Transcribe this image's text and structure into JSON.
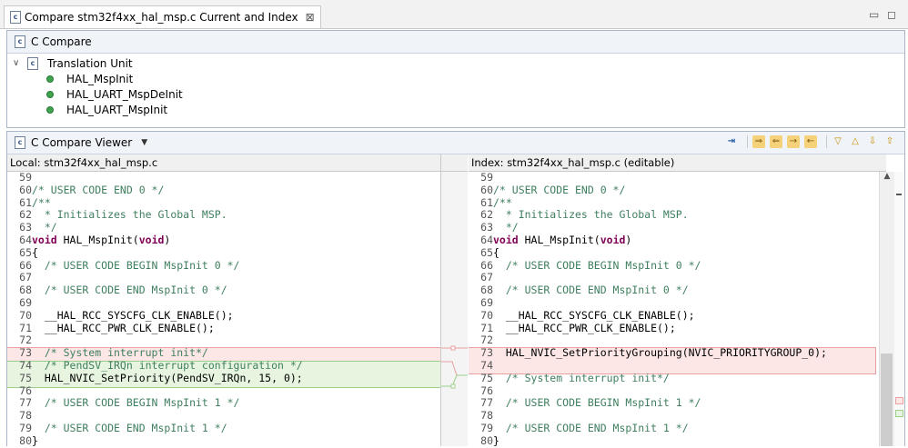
{
  "window": {
    "tab_title": "Compare stm32f4xx_hal_msp.c Current and Index",
    "close_glyph": "⊠",
    "minimize_glyph": "▭",
    "maximize_glyph": "◻"
  },
  "structure_panel": {
    "title": "C Compare",
    "tree": {
      "root_label": "Translation Unit",
      "items": [
        "HAL_MspInit",
        "HAL_UART_MspDeInit",
        "HAL_UART_MspInit"
      ]
    }
  },
  "viewer": {
    "title": "C Compare Viewer",
    "left_header": "Local: stm32f4xx_hal_msp.c",
    "right_header": "Index: stm32f4xx_hal_msp.c (editable)"
  },
  "left_lines": [
    {
      "n": "59",
      "t": ""
    },
    {
      "n": "60",
      "t": "/* USER CODE END 0 */"
    },
    {
      "n": "61",
      "t": "/**"
    },
    {
      "n": "62",
      "t": "  * Initializes the Global MSP."
    },
    {
      "n": "63",
      "t": "  */"
    },
    {
      "n": "64",
      "t": "void HAL_MspInit(void)"
    },
    {
      "n": "65",
      "t": "{"
    },
    {
      "n": "66",
      "t": "  /* USER CODE BEGIN MspInit 0 */"
    },
    {
      "n": "67",
      "t": ""
    },
    {
      "n": "68",
      "t": "  /* USER CODE END MspInit 0 */"
    },
    {
      "n": "69",
      "t": ""
    },
    {
      "n": "70",
      "t": "  __HAL_RCC_SYSCFG_CLK_ENABLE();"
    },
    {
      "n": "71",
      "t": "  __HAL_RCC_PWR_CLK_ENABLE();"
    },
    {
      "n": "72",
      "t": ""
    },
    {
      "n": "73",
      "t": "  /* System interrupt init*/"
    },
    {
      "n": "74",
      "t": "  /* PendSV_IRQn interrupt configuration */"
    },
    {
      "n": "75",
      "t": "  HAL_NVIC_SetPriority(PendSV_IRQn, 15, 0);"
    },
    {
      "n": "76",
      "t": ""
    },
    {
      "n": "77",
      "t": "  /* USER CODE BEGIN MspInit 1 */"
    },
    {
      "n": "78",
      "t": ""
    },
    {
      "n": "79",
      "t": "  /* USER CODE END MspInit 1 */"
    },
    {
      "n": "80",
      "t": "}"
    }
  ],
  "right_lines": [
    {
      "n": "59",
      "t": ""
    },
    {
      "n": "60",
      "t": "/* USER CODE END 0 */"
    },
    {
      "n": "61",
      "t": "/**"
    },
    {
      "n": "62",
      "t": "  * Initializes the Global MSP."
    },
    {
      "n": "63",
      "t": "  */"
    },
    {
      "n": "64",
      "t": "void HAL_MspInit(void)"
    },
    {
      "n": "65",
      "t": "{"
    },
    {
      "n": "66",
      "t": "  /* USER CODE BEGIN MspInit 0 */"
    },
    {
      "n": "67",
      "t": ""
    },
    {
      "n": "68",
      "t": "  /* USER CODE END MspInit 0 */"
    },
    {
      "n": "69",
      "t": ""
    },
    {
      "n": "70",
      "t": "  __HAL_RCC_SYSCFG_CLK_ENABLE();"
    },
    {
      "n": "71",
      "t": "  __HAL_RCC_PWR_CLK_ENABLE();"
    },
    {
      "n": "72",
      "t": ""
    },
    {
      "n": "73",
      "t": "  HAL_NVIC_SetPriorityGrouping(NVIC_PRIORITYGROUP_0);"
    },
    {
      "n": "74",
      "t": ""
    },
    {
      "n": "75",
      "t": "  /* System interrupt init*/"
    },
    {
      "n": "76",
      "t": ""
    },
    {
      "n": "77",
      "t": "  /* USER CODE BEGIN MspInit 1 */"
    },
    {
      "n": "78",
      "t": ""
    },
    {
      "n": "79",
      "t": "  /* USER CODE END MspInit 1 */"
    },
    {
      "n": "80",
      "t": "}"
    }
  ],
  "colors": {
    "changed_bg": "#fde6e6",
    "changed_border": "#e8a0a0",
    "added_bg": "#e6f4e0",
    "added_border": "#9ccf8a",
    "comment": "#3f7f5f",
    "keyword": "#7f0055"
  },
  "icons": {
    "toolbar": [
      "ignore-whitespace-icon",
      "copy-all-left-to-right-icon",
      "copy-all-right-to-left-icon",
      "copy-current-left-to-right-icon",
      "copy-current-right-to-left-icon",
      "next-difference-icon",
      "previous-difference-icon",
      "next-change-icon",
      "previous-change-icon"
    ]
  }
}
